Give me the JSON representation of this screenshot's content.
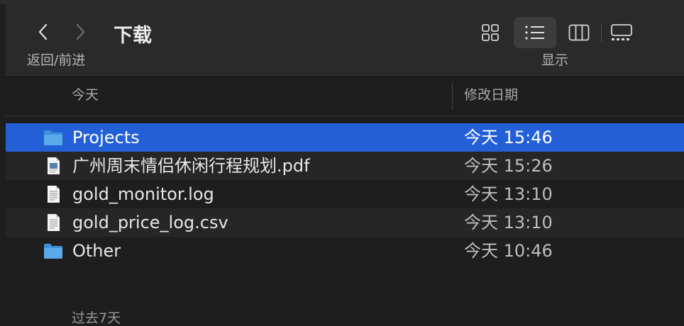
{
  "window": {
    "title": "下载",
    "nav_label": "返回/前进",
    "view_label": "显示"
  },
  "toolbar": {
    "view_modes": [
      {
        "name": "icon",
        "icon": "grid-icon",
        "active": false
      },
      {
        "name": "list",
        "icon": "list-icon",
        "active": true
      },
      {
        "name": "column",
        "icon": "columns-icon",
        "active": false
      },
      {
        "name": "gallery",
        "icon": "gallery-icon",
        "active": false
      }
    ]
  },
  "columns": {
    "name_header": "今天",
    "date_header": "修改日期"
  },
  "files": [
    {
      "name": "Projects",
      "date": "今天 15:46",
      "kind": "folder",
      "selected": true
    },
    {
      "name": "广州周末情侣休闲行程规划.pdf",
      "date": "今天 15:26",
      "kind": "pdf",
      "selected": false
    },
    {
      "name": "gold_monitor.log",
      "date": "今天 13:10",
      "kind": "document",
      "selected": false
    },
    {
      "name": "gold_price_log.csv",
      "date": "今天 13:10",
      "kind": "document",
      "selected": false
    },
    {
      "name": "Other",
      "date": "今天 10:46",
      "kind": "folder",
      "selected": false
    }
  ],
  "next_group": {
    "label": "过去7天"
  },
  "colors": {
    "selection": "#2360d8",
    "folder": "#5aa9ea",
    "background": "#1e1e1e"
  }
}
